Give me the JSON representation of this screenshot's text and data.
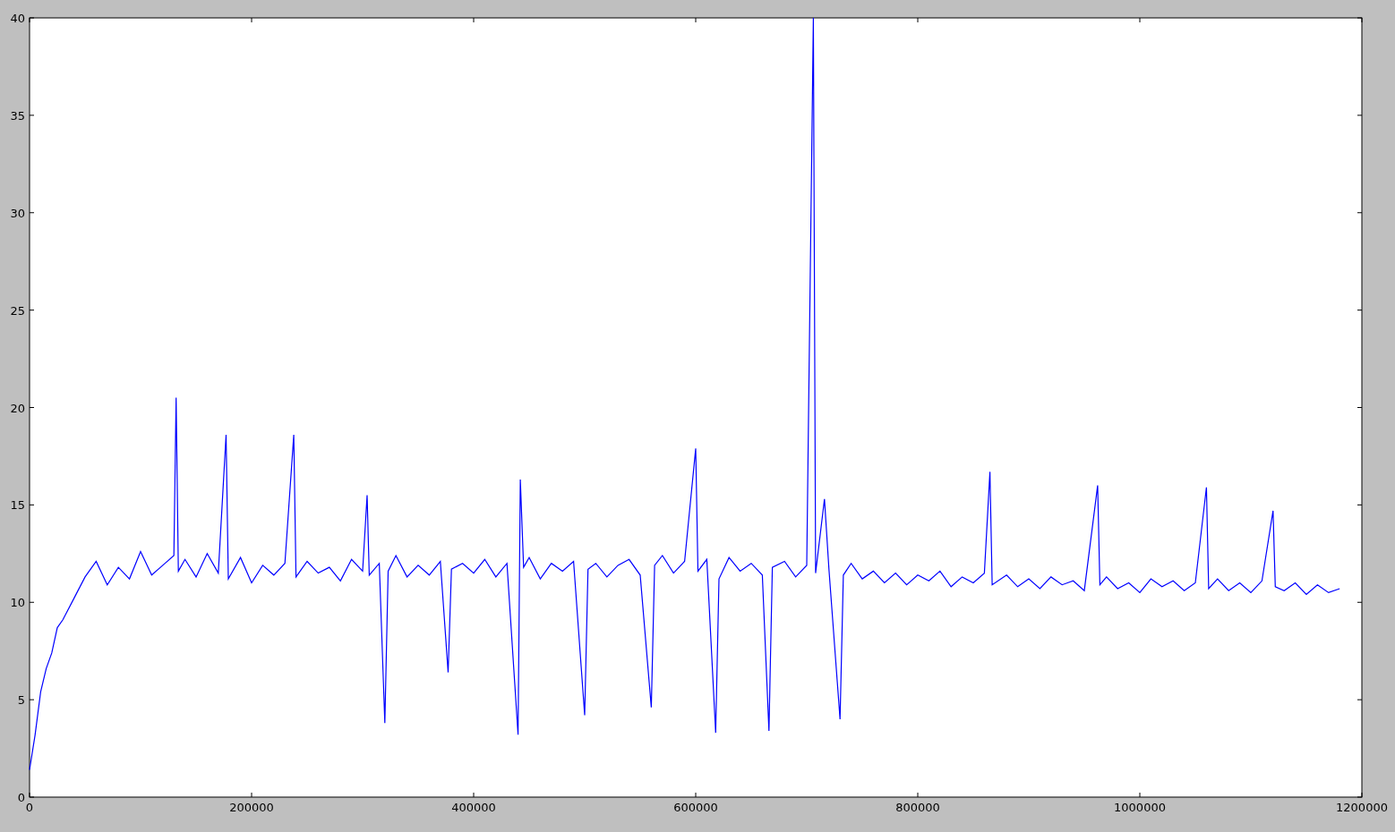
{
  "chart_data": {
    "type": "line",
    "xlim": [
      0,
      1200000
    ],
    "ylim": [
      0,
      40
    ],
    "xticks": [
      0,
      200000,
      400000,
      600000,
      800000,
      1000000,
      1200000
    ],
    "yticks": [
      0,
      5,
      10,
      15,
      20,
      25,
      30,
      35,
      40
    ],
    "x": [
      0,
      5000,
      10000,
      15000,
      20000,
      25000,
      30000,
      40000,
      50000,
      60000,
      70000,
      80000,
      90000,
      100000,
      110000,
      120000,
      130000,
      132000,
      134000,
      140000,
      150000,
      160000,
      170000,
      177000,
      179000,
      190000,
      200000,
      210000,
      220000,
      230000,
      238000,
      240000,
      250000,
      260000,
      270000,
      280000,
      290000,
      300000,
      304000,
      306000,
      315000,
      320000,
      323000,
      330000,
      340000,
      350000,
      360000,
      370000,
      377000,
      380000,
      390000,
      400000,
      410000,
      420000,
      430000,
      440000,
      442000,
      445000,
      450000,
      460000,
      470000,
      480000,
      490000,
      500000,
      503000,
      510000,
      520000,
      530000,
      540000,
      550000,
      560000,
      563000,
      570000,
      580000,
      590000,
      600000,
      602000,
      610000,
      618000,
      621000,
      630000,
      640000,
      650000,
      660000,
      666000,
      669000,
      680000,
      690000,
      700000,
      706000,
      708000,
      716000,
      720000,
      730000,
      733000,
      740000,
      750000,
      760000,
      770000,
      780000,
      790000,
      800000,
      810000,
      820000,
      830000,
      840000,
      850000,
      860000,
      865000,
      867000,
      880000,
      890000,
      900000,
      910000,
      920000,
      930000,
      940000,
      950000,
      962000,
      964000,
      970000,
      980000,
      990000,
      1000000,
      1010000,
      1020000,
      1030000,
      1040000,
      1050000,
      1060000,
      1062000,
      1070000,
      1080000,
      1090000,
      1100000,
      1110000,
      1120000,
      1122000,
      1130000,
      1140000,
      1150000,
      1160000,
      1170000,
      1180000
    ],
    "series": [
      {
        "color": "#0000ff",
        "values": [
          1.4,
          3.2,
          5.4,
          6.6,
          7.4,
          8.7,
          9.1,
          10.2,
          11.3,
          12.1,
          10.9,
          11.8,
          11.2,
          12.6,
          11.4,
          11.9,
          12.4,
          20.5,
          11.6,
          12.2,
          11.3,
          12.5,
          11.5,
          18.6,
          11.2,
          12.3,
          11.0,
          11.9,
          11.4,
          12.0,
          18.6,
          11.3,
          12.1,
          11.5,
          11.8,
          11.1,
          12.2,
          11.6,
          15.5,
          11.4,
          12.0,
          3.8,
          11.6,
          12.4,
          11.3,
          11.9,
          11.4,
          12.1,
          6.4,
          11.7,
          12.0,
          11.5,
          12.2,
          11.3,
          12.0,
          3.2,
          16.3,
          11.8,
          12.3,
          11.2,
          12.0,
          11.6,
          12.1,
          4.2,
          11.7,
          12.0,
          11.3,
          11.9,
          12.2,
          11.4,
          4.6,
          11.9,
          12.4,
          11.5,
          12.1,
          17.9,
          11.6,
          12.2,
          3.3,
          11.2,
          12.3,
          11.6,
          12.0,
          11.4,
          3.4,
          11.8,
          12.1,
          11.3,
          11.9,
          40,
          11.5,
          15.3,
          11.7,
          4.0,
          11.4,
          12.0,
          11.2,
          11.6,
          11.0,
          11.5,
          10.9,
          11.4,
          11.1,
          11.6,
          10.8,
          11.3,
          11.0,
          11.5,
          16.7,
          10.9,
          11.4,
          10.8,
          11.2,
          10.7,
          11.3,
          10.9,
          11.1,
          10.6,
          16.0,
          10.9,
          11.3,
          10.7,
          11.0,
          10.5,
          11.2,
          10.8,
          11.1,
          10.6,
          11.0,
          15.9,
          10.7,
          11.2,
          10.6,
          11.0,
          10.5,
          11.1,
          14.7,
          10.8,
          10.6,
          11.0,
          10.4,
          10.9,
          10.5,
          10.7
        ]
      }
    ]
  }
}
